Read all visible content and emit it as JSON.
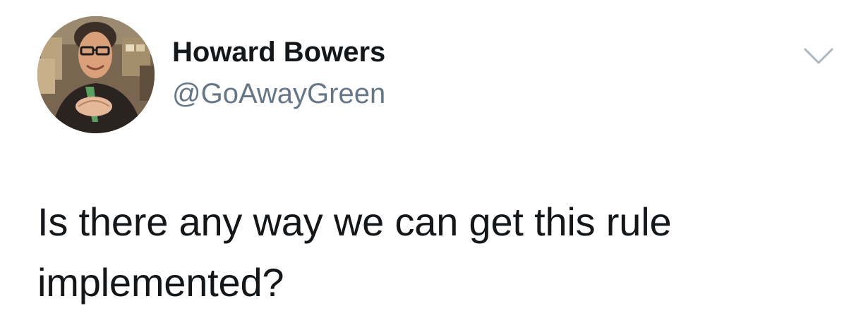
{
  "author": {
    "display_name": "Howard Bowers",
    "handle": "@GoAwayGreen",
    "avatar_icon": "user-avatar-photo"
  },
  "tweet": {
    "text": "Is there any way we can get this rule implemented?"
  },
  "actions": {
    "menu_icon": "chevron-down-icon",
    "icon_color": "#aab8c2"
  },
  "colors": {
    "name": "#14171a",
    "handle": "#657786",
    "text": "#14171a"
  }
}
